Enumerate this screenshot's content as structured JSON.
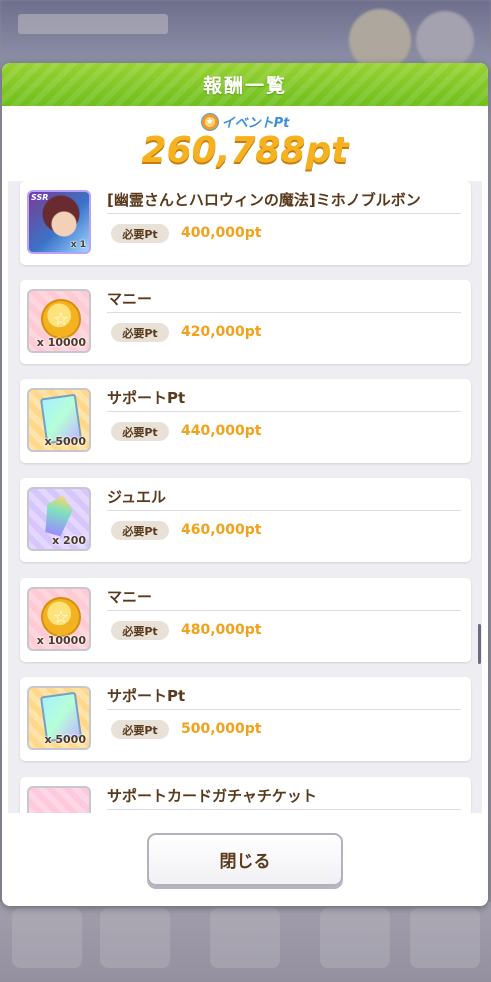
{
  "modal": {
    "title": "報酬一覧",
    "event_pt_label": "イベントPt",
    "event_pt_total": "260,788pt",
    "required_label": "必要Pt",
    "close_label": "閉じる"
  },
  "rewards": [
    {
      "name": "[幽霊さんとハロウィンの魔法]ミホノブルボン",
      "required_pt": "400,000pt",
      "quantity": "x 1",
      "icon": "ssr-support-card-icon",
      "badge": "SSR"
    },
    {
      "name": "マニー",
      "required_pt": "420,000pt",
      "quantity": "x 10000",
      "icon": "money-coin-icon"
    },
    {
      "name": "サポートPt",
      "required_pt": "440,000pt",
      "quantity": "x 5000",
      "icon": "support-pt-card-icon"
    },
    {
      "name": "ジュエル",
      "required_pt": "460,000pt",
      "quantity": "x 200",
      "icon": "jewel-icon"
    },
    {
      "name": "マニー",
      "required_pt": "480,000pt",
      "quantity": "x 10000",
      "icon": "money-coin-icon"
    },
    {
      "name": "サポートPt",
      "required_pt": "500,000pt",
      "quantity": "x 5000",
      "icon": "support-pt-card-icon"
    },
    {
      "name": "サポートカードガチャチケット",
      "icon": "gacha-ticket-icon"
    }
  ],
  "colors": {
    "header_green": "#7dc623",
    "points_gold": "#f6b21e",
    "required_value_orange": "#f2a11a",
    "text_brown": "#5a3a1c"
  }
}
